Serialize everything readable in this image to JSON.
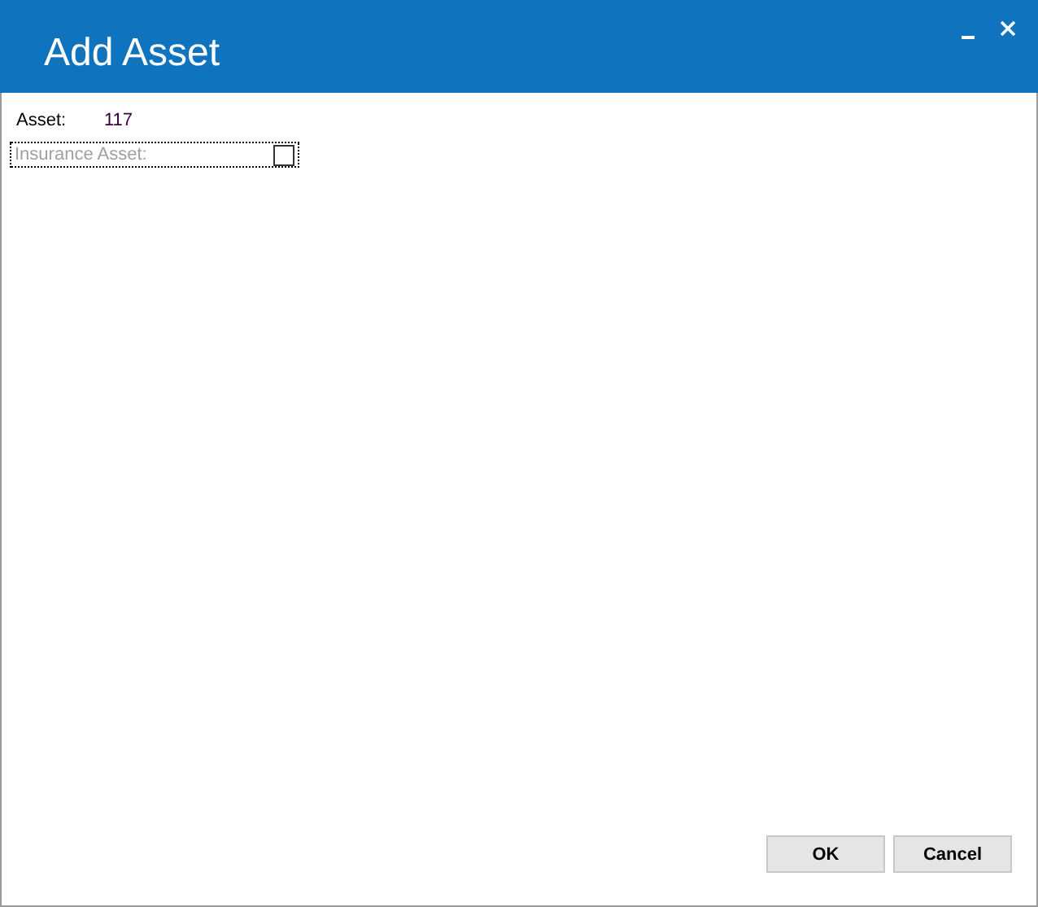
{
  "window": {
    "title": "Add Asset",
    "controls": [
      {
        "kind": "minimize"
      },
      {
        "kind": "close"
      }
    ]
  },
  "fields": [
    {
      "label": "Asset:",
      "value": "117"
    }
  ],
  "insurance": {
    "label": "Insurance Asset:",
    "checked": false,
    "disabled": true,
    "focused": true
  },
  "buttons": [
    "OK",
    "Cancel"
  ]
}
